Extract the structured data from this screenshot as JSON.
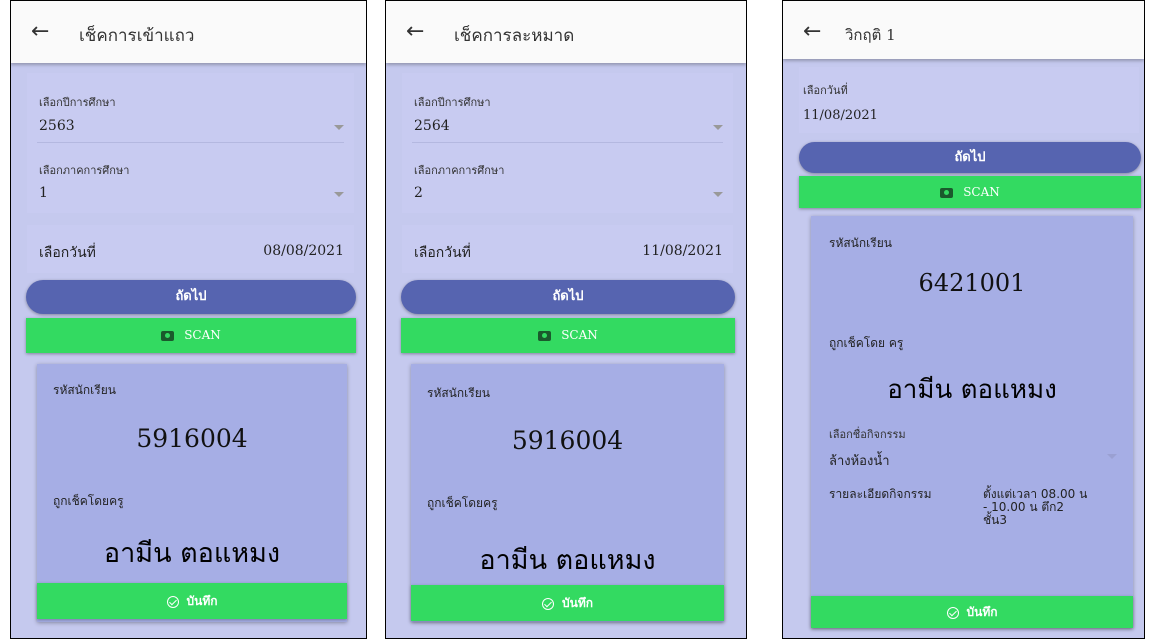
{
  "panel1": {
    "title": "เช็คการเข้าแถว",
    "year_label": "เลือกปีการศึกษา",
    "year_value": "2563",
    "term_label": "เลือกภาคการศึกษา",
    "term_value": "1",
    "date_label": "เลือกวันที่",
    "date_value": "08/08/2021",
    "next_label": "ถัดไป",
    "scan_label": "SCAN",
    "student_id_label": "รหัสนักเรียน",
    "student_id": "5916004",
    "checked_by_label": "ถูกเช็คโดยครู",
    "teacher_name": "อามีน ตอแหมง",
    "save_label": "บันทึก"
  },
  "panel2": {
    "title": "เช็คการละหมาด",
    "year_label": "เลือกปีการศึกษา",
    "year_value": "2564",
    "term_label": "เลือกภาคการศึกษา",
    "term_value": "2",
    "date_label": "เลือกวันที่",
    "date_value": "11/08/2021",
    "next_label": "ถัดไป",
    "scan_label": "SCAN",
    "student_id_label": "รหัสนักเรียน",
    "student_id": "5916004",
    "checked_by_label": "ถูกเช็คโดยครู",
    "teacher_name": "อามีน ตอแหมง",
    "save_label": "บันทึก"
  },
  "panel3": {
    "title": "วิกฤติ 1",
    "date_label": "เลือกวันที่",
    "date_value": "11/08/2021",
    "next_label": "ถัดไป",
    "scan_label": "SCAN",
    "student_id_label": "รหัสนักเรียน",
    "student_id": "6421001",
    "checked_by_label": "ถูกเช็คโดย ครู",
    "teacher_name": "อามีน ตอแหมง",
    "activity_label": "เลือกชื่อกิจกรรม",
    "activity_value": "ล้างห้องน้ำ",
    "detail_label": "รายละเอียดกิจกรรม",
    "detail_line1": "ตั้งแต่เวลา 08.00 น",
    "detail_line2": "- 10.00 น ตึก2",
    "detail_line3": "ชั้น3",
    "save_label": "บันทึก"
  },
  "colors": {
    "background": "#c5c9ee",
    "next_button": "#5664b0",
    "scan_button": "#33da61",
    "card": "#a6aee5"
  }
}
